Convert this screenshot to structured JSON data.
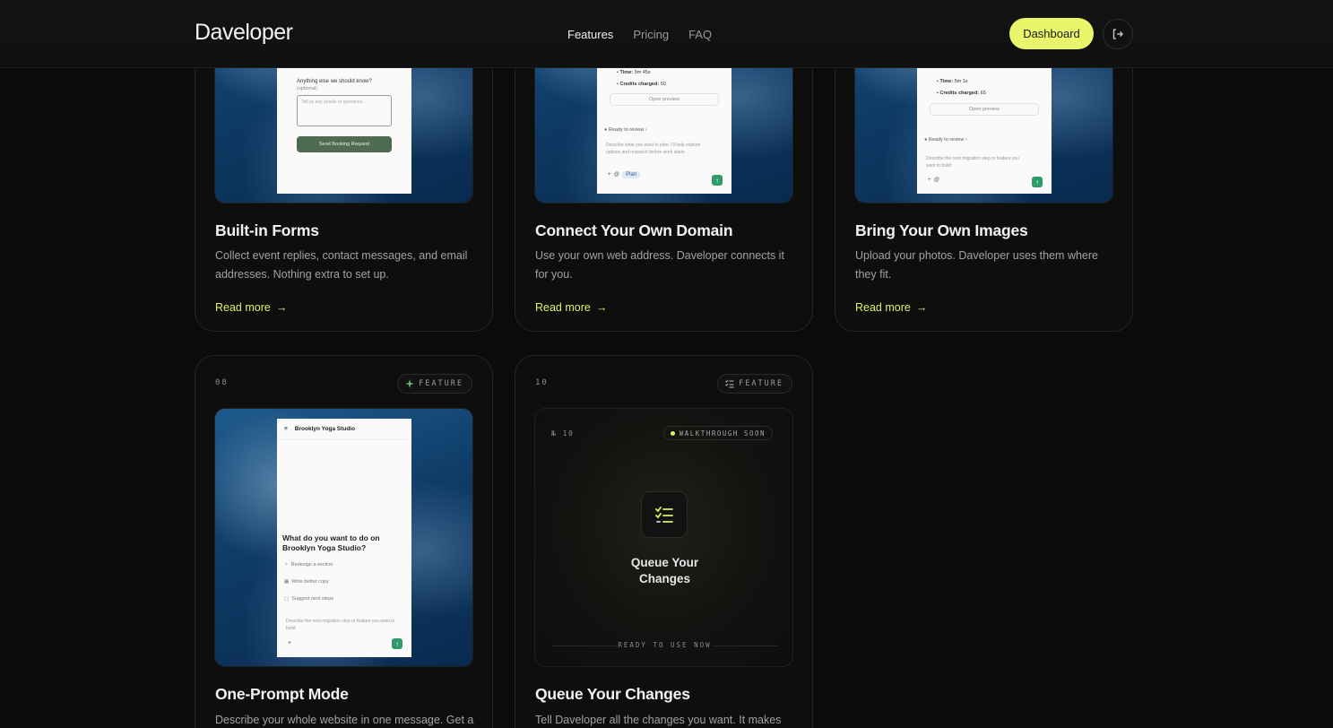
{
  "header": {
    "logo": "Daveloper",
    "nav": [
      {
        "label": "Features",
        "active": true
      },
      {
        "label": "Pricing",
        "active": false
      },
      {
        "label": "FAQ",
        "active": false
      }
    ],
    "dashboard_label": "Dashboard",
    "logout_icon": "logout-icon"
  },
  "accent_color": "#e9f56b",
  "cards_top": [
    {
      "title": "Built-in Forms",
      "description": "Collect event replies, contact messages, and email addresses. Nothing extra to set up.",
      "read_more": "Read more",
      "mock": {
        "question": "Anything else we should know?",
        "optional": "(optional)",
        "placeholder": "Tell us any details or questions...",
        "button": "Send Booking Request"
      }
    },
    {
      "title": "Connect Your Own Domain",
      "description": "Use your own web address. Daveloper connects it for you.",
      "read_more": "Read more",
      "mock": {
        "time_label": "Time:",
        "time_value": "3m 45s",
        "credits_label": "Credits charged:",
        "credits_value": "50",
        "open_preview": "Open preview",
        "ready": "Ready to review",
        "input": "Describe what you want to plan. I'll help explore options and research before work starts",
        "chip": "Plan"
      }
    },
    {
      "title": "Bring Your Own Images",
      "description": "Upload your photos. Daveloper uses them where they fit.",
      "read_more": "Read more",
      "mock": {
        "time_label": "Time:",
        "time_value": "5m 1s",
        "credits_label": "Credits charged:",
        "credits_value": "65",
        "open_preview": "Open preview",
        "ready": "Ready to review",
        "input": "Describe the next migration step or feature you want to build"
      }
    }
  ],
  "cards_bottom": [
    {
      "number": "08",
      "tag": "FEATURE",
      "tag_icon": "sparkle-icon",
      "title": "One-Prompt Mode",
      "description": "Describe your whole website in one message. Get a",
      "mock": {
        "studio": "Brooklyn Yoga Studio",
        "question": "What do you want to do on Brooklyn Yoga Studio?",
        "options": [
          "Redesign a section",
          "Write better copy",
          "Suggest next steps"
        ],
        "input": "Describe the next migration step or feature you want to build"
      }
    },
    {
      "number": "10",
      "tag": "FEATURE",
      "tag_icon": "list-check-icon",
      "title": "Queue Your Changes",
      "description": "Tell Daveloper all the changes you want. It makes",
      "placeholder": {
        "index": "№ 10",
        "pill": "WALKTHROUGH SOON",
        "title": "Queue Your Changes",
        "footer": "READY TO USE NOW"
      }
    }
  ]
}
